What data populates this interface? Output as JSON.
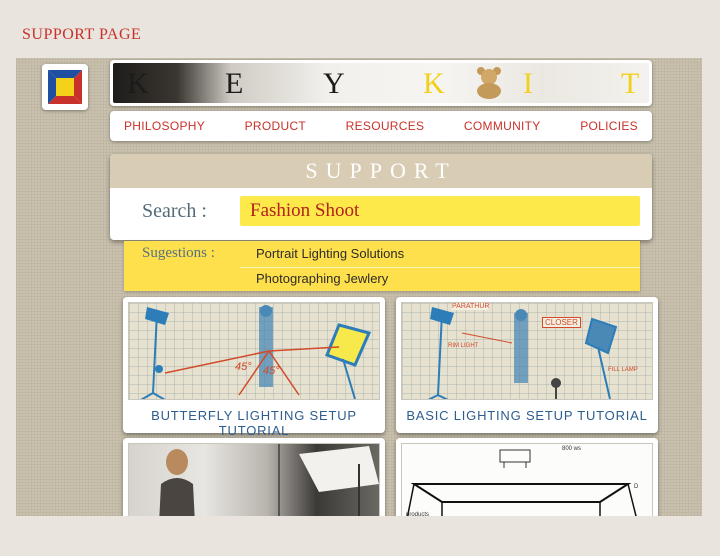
{
  "page_label": "SUPPORT PAGE",
  "banner_letters": [
    "K",
    "E",
    "Y",
    "K",
    "I",
    "T"
  ],
  "nav": [
    "PHILOSOPHY",
    "PRODUCT",
    "RESOURCES",
    "COMMUNITY",
    "POLICIES"
  ],
  "support": {
    "heading": "SUPPORT",
    "search_label": "Search :",
    "search_value": "Fashion Shoot"
  },
  "suggestions": {
    "label": "Sugestions :",
    "items": [
      "Portrait Lighting Solutions",
      "Photographing Jewlery"
    ]
  },
  "cards": [
    {
      "title": "BUTTERFLY LIGHTING SETUP TUTORIAL",
      "annotations": [
        "45°",
        "45°"
      ]
    },
    {
      "title": "BASIC LIGHTING SETUP TUTORIAL",
      "annotations": [
        "PARATHUR",
        "CLOSER",
        "RIM LIGHT",
        "FILL LAMP"
      ]
    },
    {
      "title": ""
    },
    {
      "title": "",
      "annotations": [
        "800 ws",
        "D",
        "products"
      ]
    }
  ],
  "colors": {
    "accent_red": "#c8322a",
    "search_yellow": "#fde94a",
    "title_blue": "#2d5c8e"
  }
}
